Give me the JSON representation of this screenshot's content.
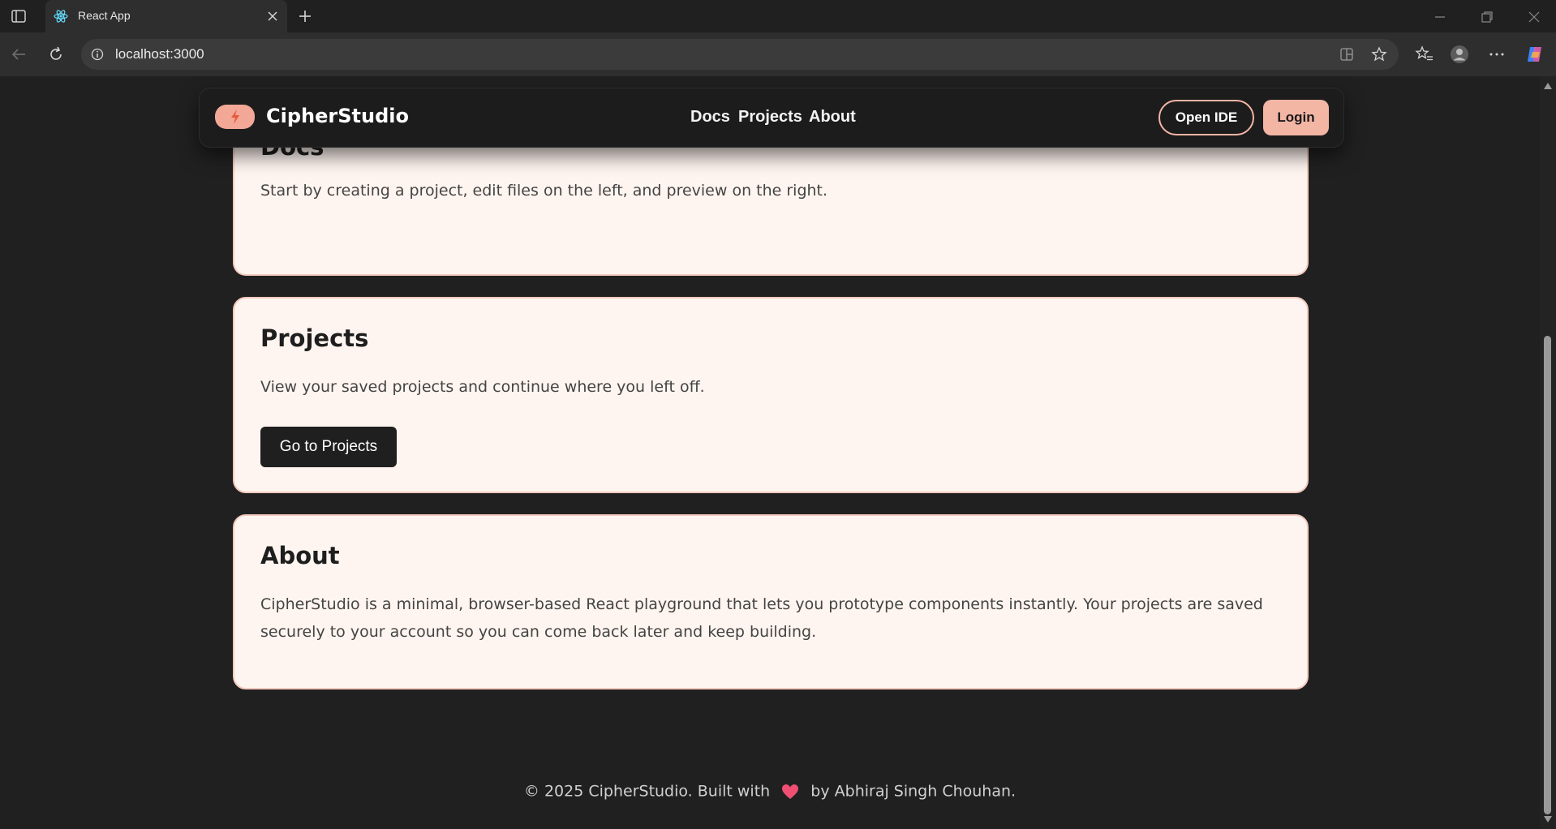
{
  "browser": {
    "tab_title": "React App",
    "url": "localhost:3000"
  },
  "header": {
    "brand": "CipherStudio",
    "nav": [
      "Docs",
      "Projects",
      "About"
    ],
    "open_ide_label": "Open IDE",
    "login_label": "Login"
  },
  "sections": {
    "docs": {
      "title": "Docs",
      "text": "Start by creating a project, edit files on the left, and preview on the right."
    },
    "projects": {
      "title": "Projects",
      "text": "View your saved projects and continue where you left off.",
      "button_label": "Go to Projects"
    },
    "about": {
      "title": "About",
      "text": "CipherStudio is a minimal, browser-based React playground that lets you prototype components instantly. Your projects are saved securely to your account so you can come back later and keep building."
    }
  },
  "footer": {
    "before": "© 2025 CipherStudio. Built with",
    "after": "by Abhiraj Singh Chouhan."
  },
  "colors": {
    "accent": "#f3b5a4",
    "card_bg": "#fff5f0",
    "page_bg": "#202020"
  }
}
